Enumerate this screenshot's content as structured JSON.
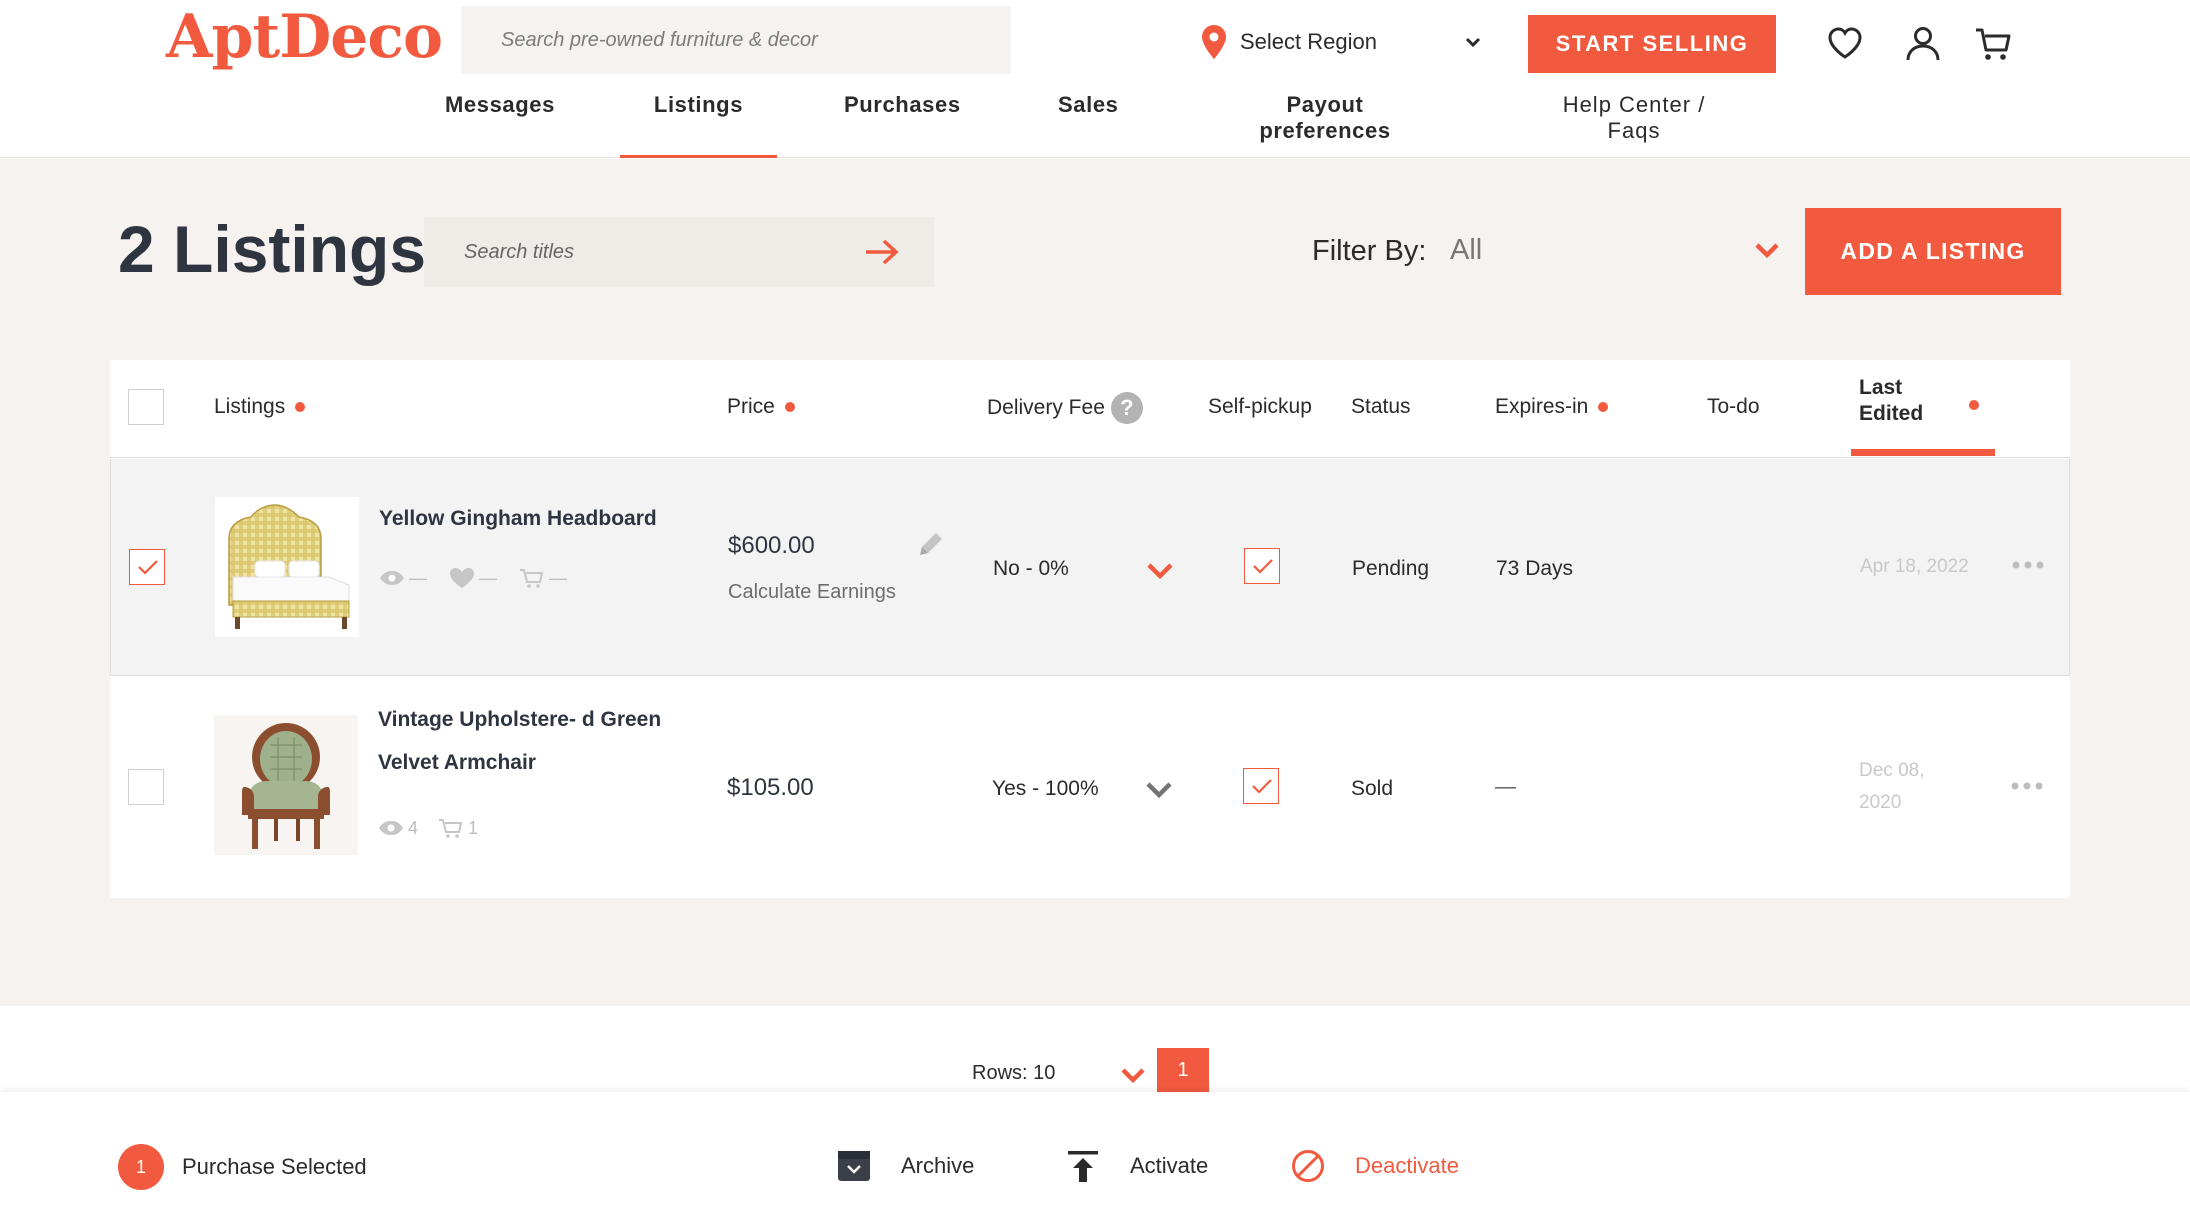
{
  "header": {
    "logo": "AptDeco",
    "search_placeholder": "Search pre-owned furniture & decor",
    "region_label": "Select Region",
    "start_selling": "START SELLING",
    "nav": [
      {
        "label": "Messages"
      },
      {
        "label": "Listings"
      },
      {
        "label": "Purchases"
      },
      {
        "label": "Sales"
      },
      {
        "label": "Payout preferences"
      },
      {
        "label": "Help Center / Faqs"
      }
    ]
  },
  "main": {
    "title": "2 Listings",
    "search_placeholder": "Search titles",
    "filter_label": "Filter By:",
    "filter_value": "All",
    "add_listing": "ADD A LISTING"
  },
  "table": {
    "columns": {
      "listings": "Listings",
      "price": "Price",
      "delivery_fee": "Delivery Fee",
      "self_pickup": "Self-pickup",
      "status": "Status",
      "expires_in": "Expires-in",
      "todo": "To-do",
      "last_edited_1": "Last",
      "last_edited_2": "Edited"
    },
    "rows": [
      {
        "title": "Yellow Gingham Headboard",
        "views": "—",
        "likes": "—",
        "carts": "—",
        "price": "$600.00",
        "calc": "Calculate Earnings",
        "delivery": "No - 0%",
        "status": "Pending",
        "expires": "73 Days",
        "last_edited": "Apr 18, 2022"
      },
      {
        "title_1": "Vintage Upholstere- d Green",
        "title_2": "Velvet Armchair",
        "views": "4",
        "carts": "1",
        "price": "$105.00",
        "delivery": "Yes - 100%",
        "status": "Sold",
        "expires": "—",
        "last_edited_1": "Dec 08,",
        "last_edited_2": "2020"
      }
    ]
  },
  "pager": {
    "rows_label": "Rows: 10",
    "page": "1"
  },
  "actionbar": {
    "count": "1",
    "selected_label": "Purchase Selected",
    "archive": "Archive",
    "activate": "Activate",
    "deactivate": "Deactivate"
  },
  "colors": {
    "accent": "#f15a3e",
    "page_bg": "#f5f2ef",
    "text": "#2f3540"
  },
  "icons": [
    "location-pin-icon",
    "chevron-down-icon",
    "heart-icon",
    "user-icon",
    "cart-icon",
    "arrow-right-icon",
    "help-icon",
    "eye-icon",
    "pencil-icon",
    "more-icon",
    "archive-icon",
    "activate-icon",
    "deactivate-icon"
  ]
}
